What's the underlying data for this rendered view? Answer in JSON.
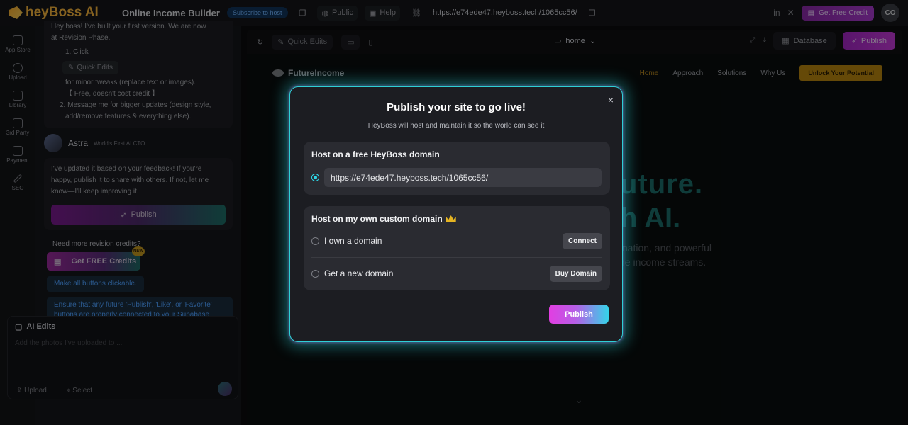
{
  "topbar": {
    "logo": "heyBoss AI",
    "project_title": "Online Income Builder",
    "subscribe": "Subscribe to host",
    "public": "Public",
    "help": "Help",
    "url": "https://e74ede47.heyboss.tech/1065cc56/",
    "get_free_credit": "Get Free Credit",
    "avatar": "CO"
  },
  "rail": [
    {
      "label": "App Store",
      "icon": "grid-icon"
    },
    {
      "label": "Upload",
      "icon": "cloud-upload-icon"
    },
    {
      "label": "Library",
      "icon": "library-icon"
    },
    {
      "label": "3rd Party",
      "icon": "store-icon"
    },
    {
      "label": "Payment",
      "icon": "payment-icon"
    },
    {
      "label": "SEO",
      "icon": "wand-icon"
    }
  ],
  "chat": {
    "intro_line1": "Hey boss! I've built your first version. We are now",
    "intro_line2": "at Revision Phase.",
    "step1": "1.  Click",
    "quick_edits_chip": "Quick Edits",
    "step1_b": "for minor tweaks (replace text or images).",
    "step1_c": "【 Free, doesn't cost credit 】",
    "step2_a": "2.  Message me for bigger updates (design style,",
    "step2_b": "add/remove features & everything else).",
    "astra_name": "Astra",
    "astra_tag": "World's First AI CTO",
    "reply_1": "I've updated it based on your feedback! If you're",
    "reply_2": "happy, publish it to share with others. If not, let me",
    "reply_3": "know—I'll keep improving it.",
    "publish_label": "Publish",
    "need_credits": "Need more revision credits?",
    "free_credits": "Get FREE Credits",
    "new_badge": "NEW",
    "suggestion_1": "Make all buttons clickable.",
    "suggestion_2": "Ensure that any future 'Publish', 'Like', or 'Favorite' buttons are properly connected to your Supabase database for reliable data handling."
  },
  "ai_edits": {
    "title": "AI Edits",
    "placeholder": "Add the photos I've uploaded to ...",
    "upload": "Upload",
    "select": "Select"
  },
  "preview": {
    "quick_edits": "Quick Edits",
    "page": "home",
    "database": "Database",
    "publish": "Publish",
    "site": {
      "brand": "FutureIncome",
      "links": [
        "Home",
        "Approach",
        "Solutions",
        "Why Us"
      ],
      "cta": "Unlock Your Potential",
      "hero_line1": "uture.",
      "hero_line2": "h AI.",
      "para_line1": "mation, and powerful",
      "para_line2": "ne income streams."
    }
  },
  "modal": {
    "title": "Publish your site to go live!",
    "subtitle": "HeyBoss will host and maintain it so the world can see it",
    "free_domain_title": "Host on a free HeyBoss domain",
    "free_domain_url": "https://e74ede47.heyboss.tech/1065cc56/",
    "custom_title": "Host on my own custom domain",
    "own_domain": "I own a domain",
    "connect": "Connect",
    "new_domain": "Get a new domain",
    "buy_domain": "Buy Domain",
    "publish": "Publish",
    "close": "×"
  },
  "colors": {
    "accent_cyan": "#2ed0d6",
    "accent_magenta": "#e23ee2",
    "brand_gold": "#f5b33b"
  }
}
